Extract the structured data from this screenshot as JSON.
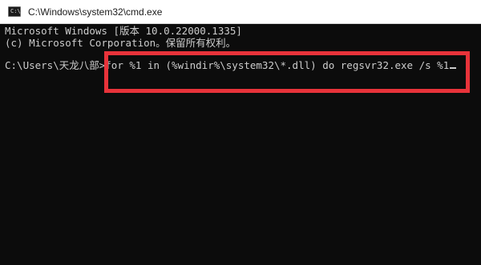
{
  "window": {
    "title": "C:\\Windows\\system32\\cmd.exe",
    "icon": "command-prompt-icon"
  },
  "console": {
    "lines": [
      "Microsoft Windows [版本 10.0.22000.1335]",
      "(c) Microsoft Corporation。保留所有权利。",
      ""
    ],
    "prompt": "C:\\Users\\天龙八部>",
    "command": "for %1 in (%windir%\\system32\\*.dll) do regsvr32.exe /s %1"
  },
  "colors": {
    "console_background": "#0c0c0c",
    "console_text": "#cccccc",
    "titlebar_background": "#ffffff",
    "annotation_border": "#e8333a"
  }
}
